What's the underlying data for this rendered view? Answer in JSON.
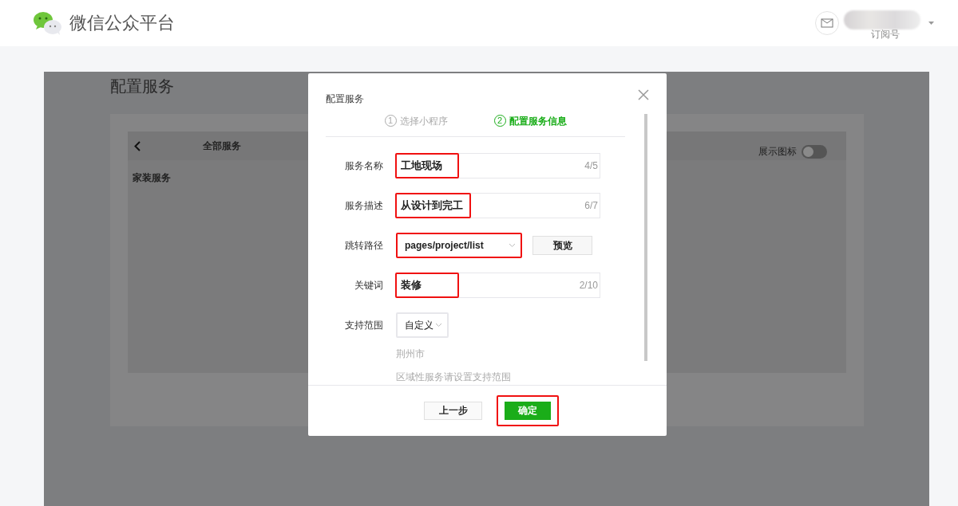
{
  "header": {
    "title": "微信公众平台",
    "account_type": "订阅号"
  },
  "page": {
    "title": "配置服务",
    "panel": {
      "back_title": "全部服务",
      "category": "家装服务",
      "show_icon": {
        "label": "展示图标",
        "on": false
      }
    }
  },
  "dialog": {
    "title": "配置服务",
    "steps": [
      {
        "number": "1",
        "label": "选择小程序",
        "selected": false
      },
      {
        "number": "2",
        "label": "配置服务信息",
        "selected": true
      }
    ],
    "fields": [
      {
        "kind": "text",
        "label": "服务名称",
        "value": "工地现场",
        "counter": "4/5",
        "highlighted": true
      },
      {
        "kind": "text",
        "label": "服务描述",
        "value": "从设计到完工",
        "counter": "6/7",
        "highlighted": true
      },
      {
        "kind": "select",
        "label": "跳转路径",
        "value": "pages/project/list",
        "button": "预览",
        "highlighted": true
      },
      {
        "kind": "text",
        "label": "关键词",
        "value": "装修",
        "counter": "2/10",
        "highlighted": true
      },
      {
        "kind": "select",
        "label": "支持范围",
        "value": "自定义",
        "highlighted": false,
        "notes": [
          "荆州市",
          "区域性服务请设置支持范围"
        ]
      }
    ],
    "buttons": [
      {
        "label": "上一步",
        "kind": "secondary",
        "highlighted": false
      },
      {
        "label": "确定",
        "kind": "primary",
        "highlighted": true
      }
    ]
  }
}
